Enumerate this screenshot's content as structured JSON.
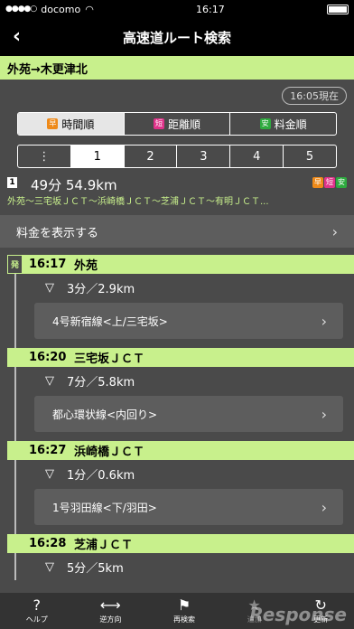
{
  "status": {
    "carrier": "docomo",
    "time": "16:17"
  },
  "nav": {
    "title": "高速道ルート検索"
  },
  "route": {
    "title": "外苑→木更津北"
  },
  "current_time": "16:05現在",
  "sort_tabs": [
    {
      "badge": "早",
      "label": "時間順",
      "color": "#ee8a1a"
    },
    {
      "badge": "短",
      "label": "距離順",
      "color": "#e0338a"
    },
    {
      "badge": "安",
      "label": "料金順",
      "color": "#2eaa3f"
    }
  ],
  "page_tabs": [
    "⋮",
    "1",
    "2",
    "3",
    "4",
    "5"
  ],
  "summary": {
    "num": "1",
    "time": "49分  54.9km",
    "badges": [
      "早",
      "短",
      "安"
    ],
    "path": "外苑〜三宅坂ＪＣＴ〜浜崎橋ＪＣＴ〜芝浦ＪＣＴ〜有明ＪＣＴ..."
  },
  "fee": {
    "label": "料金を表示する"
  },
  "depart_badge": "発",
  "stops": [
    {
      "time": "16:17",
      "name": "外苑",
      "seg": "3分／2.9km",
      "road": "4号新宿線<上/三宅坂>"
    },
    {
      "time": "16:20",
      "name": "三宅坂ＪＣＴ",
      "seg": "7分／5.8km",
      "road": "都心環状線<内回り>"
    },
    {
      "time": "16:27",
      "name": "浜崎橋ＪＣＴ",
      "seg": "1分／0.6km",
      "road": "1号羽田線<下/羽田>"
    },
    {
      "time": "16:28",
      "name": "芝浦ＪＣＴ",
      "seg": "5分／5km"
    }
  ],
  "toolbar": [
    {
      "label": "ヘルプ",
      "icon": "?"
    },
    {
      "label": "逆方向",
      "icon": "⟷"
    },
    {
      "label": "再検索",
      "icon": "⚑"
    },
    {
      "label": "追加",
      "icon": "★"
    },
    {
      "label": "更新",
      "icon": "↻"
    }
  ],
  "watermark": "Response"
}
